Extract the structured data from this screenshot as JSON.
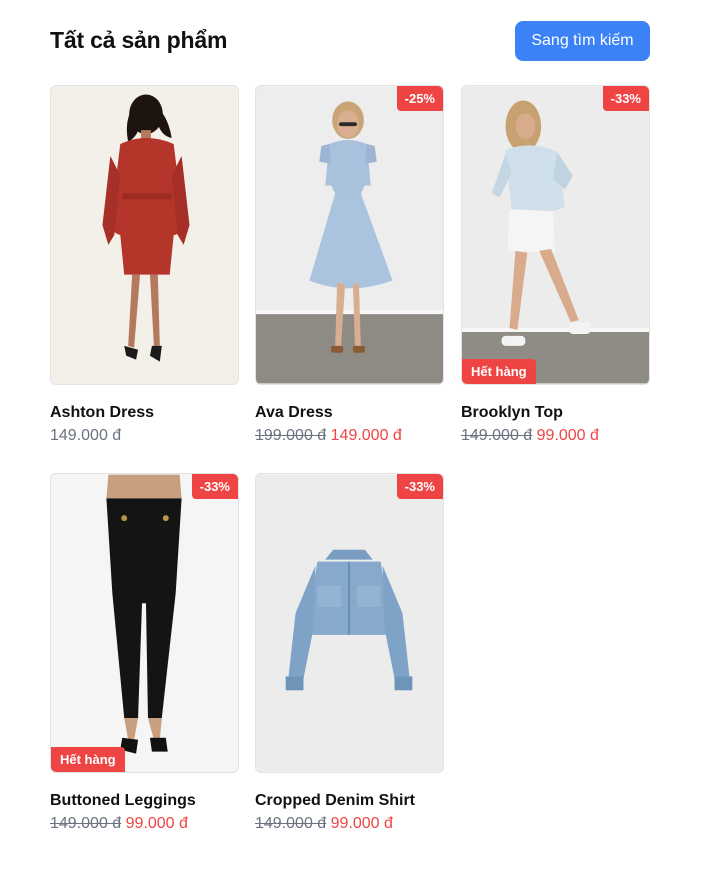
{
  "header": {
    "title": "Tất cả sản phẩm",
    "search_button_label": "Sang tìm kiếm"
  },
  "colors": {
    "accent": "#3b82f6",
    "sale": "#ef4444",
    "muted": "#6b7280"
  },
  "products": [
    {
      "name": "Ashton Dress",
      "price": "149.000 đ",
      "original_price": "",
      "discount": "",
      "status": "",
      "image": "red-dress-back-photo"
    },
    {
      "name": "Ava Dress",
      "price": "149.000 đ",
      "original_price": "199.000 đ",
      "discount": "-25%",
      "status": "",
      "image": "blue-dress-photo"
    },
    {
      "name": "Brooklyn Top",
      "price": "99.000 đ",
      "original_price": "149.000 đ",
      "discount": "-33%",
      "status": "Hết hàng",
      "image": "white-shirt-top-photo"
    },
    {
      "name": "Buttoned Leggings",
      "price": "99.000 đ",
      "original_price": "149.000 đ",
      "discount": "-33%",
      "status": "Hết hàng",
      "image": "black-leggings-photo"
    },
    {
      "name": "Cropped Denim Shirt",
      "price": "99.000 đ",
      "original_price": "149.000 đ",
      "discount": "-33%",
      "status": "",
      "image": "denim-shirt-photo"
    }
  ]
}
